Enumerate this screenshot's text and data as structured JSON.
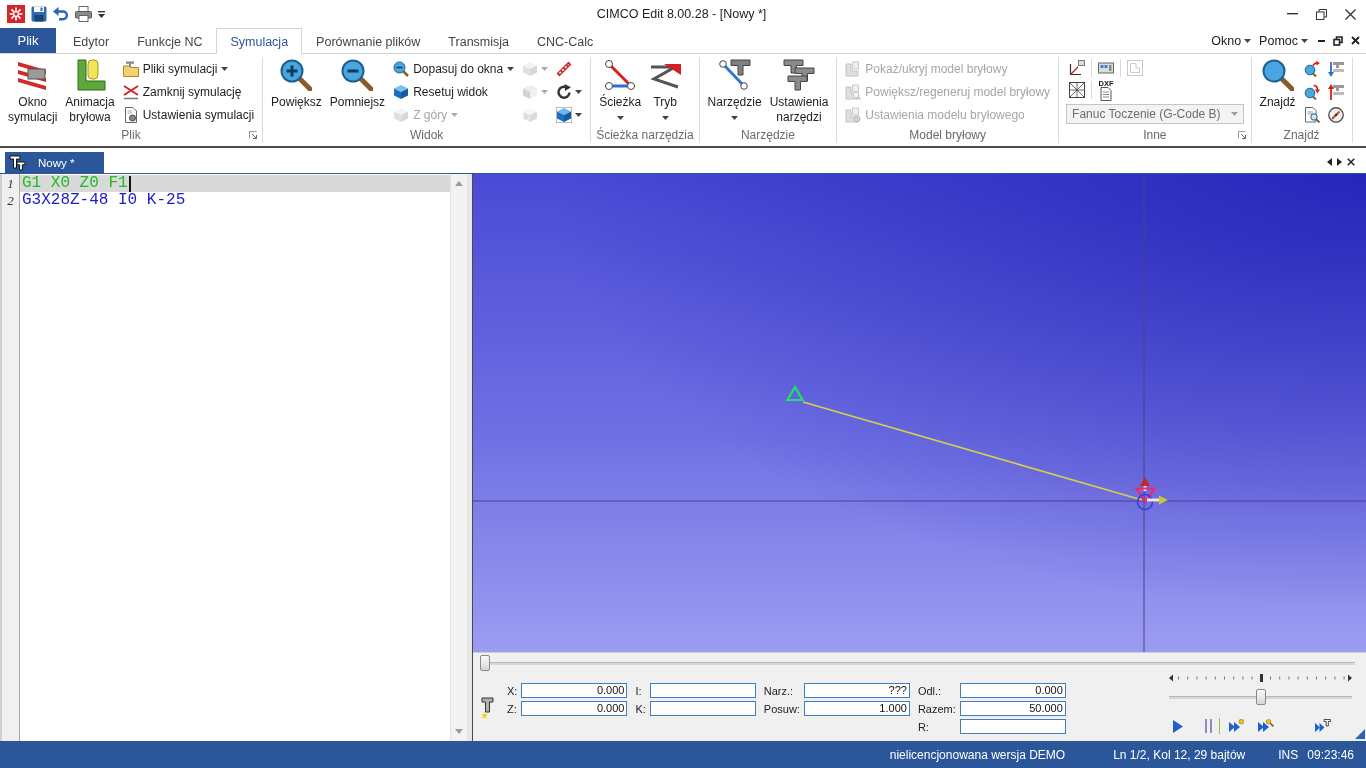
{
  "window": {
    "title": "CIMCO Edit 8.00.28 - [Nowy *]"
  },
  "ribbon": {
    "file_button": "Plik",
    "tabs": [
      {
        "label": "Edytor",
        "selected": false
      },
      {
        "label": "Funkcje NC",
        "selected": false
      },
      {
        "label": "Symulacja",
        "selected": true
      },
      {
        "label": "Porównanie plików",
        "selected": false
      },
      {
        "label": "Transmisja",
        "selected": false
      },
      {
        "label": "CNC-Calc",
        "selected": false
      }
    ],
    "menus": [
      {
        "label": "Okno"
      },
      {
        "label": "Pomoc"
      }
    ],
    "groups": [
      {
        "label": "Plik",
        "launcher": true,
        "columns": [
          {
            "kind": "large",
            "label": "Okno symulacji",
            "dropdown": false,
            "disabled": false
          },
          {
            "kind": "large",
            "label": "Animacja bryłowa",
            "dropdown": false,
            "disabled": false
          },
          {
            "kind": "stack",
            "items": [
              {
                "label": "Pliki symulacji",
                "dropdown": true,
                "disabled": false
              },
              {
                "label": "Zamknij symulację",
                "dropdown": false,
                "disabled": false
              },
              {
                "label": "Ustawienia symulacji",
                "dropdown": false,
                "disabled": false
              }
            ]
          }
        ]
      },
      {
        "label": "Widok",
        "launcher": false,
        "columns": [
          {
            "kind": "large",
            "label": "Powiększ",
            "dropdown": false,
            "disabled": false
          },
          {
            "kind": "large",
            "label": "Pomniejsz",
            "dropdown": false,
            "disabled": false
          },
          {
            "kind": "stack",
            "items": [
              {
                "label": "Dopasuj do okna",
                "dropdown": true,
                "disabled": false
              },
              {
                "label": "Resetuj widok",
                "dropdown": false,
                "disabled": false
              },
              {
                "label": "Z góry",
                "dropdown": true,
                "disabled": true
              }
            ]
          },
          {
            "kind": "icons",
            "items": [
              {
                "dropdown": true,
                "disabled": true
              },
              {
                "dropdown": true,
                "disabled": true
              },
              {
                "dropdown": false,
                "disabled": true
              }
            ]
          },
          {
            "kind": "icons",
            "items": [
              {
                "dropdown": false,
                "disabled": false
              },
              {
                "dropdown": true,
                "disabled": false
              },
              {
                "dropdown": true,
                "disabled": false
              }
            ]
          }
        ]
      },
      {
        "label": "Ścieżka narzędzia",
        "launcher": false,
        "columns": [
          {
            "kind": "large",
            "label": "Ścieżka",
            "dropdown": true,
            "disabled": false
          },
          {
            "kind": "large",
            "label": "Tryb",
            "dropdown": true,
            "disabled": false
          }
        ]
      },
      {
        "label": "Narzędzie",
        "launcher": false,
        "columns": [
          {
            "kind": "large",
            "label": "Narzędzie",
            "dropdown": true,
            "disabled": false
          },
          {
            "kind": "large",
            "label": "Ustawienia narzędzi",
            "dropdown": false,
            "disabled": false
          }
        ]
      },
      {
        "label": "Model bryłowy",
        "launcher": false,
        "columns": [
          {
            "kind": "stack",
            "items": [
              {
                "label": "Pokaż/ukryj model bryłowy",
                "dropdown": false,
                "disabled": true
              },
              {
                "label": "Powiększ/regeneruj model bryłowy",
                "dropdown": false,
                "disabled": true
              },
              {
                "label": "Ustawienia modelu bryłowego",
                "dropdown": false,
                "disabled": true
              }
            ]
          }
        ]
      },
      {
        "label": "Inne",
        "launcher": true,
        "columns": [
          {
            "kind": "panel",
            "icon_rows": [
              [
                {
                  "disabled": false
                },
                {
                  "disabled": false
                },
                {
                  "disabled": true
                }
              ],
              [
                {
                  "disabled": false
                },
                {
                  "caption": "DXF",
                  "disabled": false
                }
              ]
            ],
            "combo": {
              "value": "Fanuc Toczenie (G-Code B)",
              "disabled": true
            }
          }
        ]
      },
      {
        "label": "Znajdź",
        "launcher": false,
        "columns": [
          {
            "kind": "large",
            "label": "Znajdź",
            "dropdown": false,
            "disabled": false
          },
          {
            "kind": "icons",
            "items": [
              {
                "dropdown": false,
                "disabled": false
              },
              {
                "dropdown": false,
                "disabled": false
              },
              {
                "dropdown": false,
                "disabled": false
              }
            ]
          },
          {
            "kind": "icons",
            "items": [
              {
                "dropdown": false,
                "disabled": false
              },
              {
                "dropdown": false,
                "disabled": false
              },
              {
                "dropdown": false,
                "disabled": false
              }
            ]
          }
        ]
      }
    ]
  },
  "document_tabs": [
    {
      "label": "Nowy *",
      "selected": true
    }
  ],
  "editor": {
    "lines": [
      {
        "number": "1",
        "text": "G1 X0 Z0 F1",
        "current": true
      },
      {
        "number": "2",
        "text": "G3X28Z-48 I0 K-25",
        "current": false
      }
    ]
  },
  "simulation": {
    "timeline": {
      "level": 0
    },
    "readout_columns": [
      {
        "fields": [
          {
            "label": "X:",
            "value": "0.000"
          },
          {
            "label": "Z:",
            "value": "0.000"
          }
        ]
      },
      {
        "fields": [
          {
            "label": "I:"
          },
          {
            "label": "K:"
          }
        ]
      },
      {
        "fields": [
          {
            "label": "Narz.:",
            "value": "???"
          },
          {
            "label": "Posuw:",
            "value": "1.000"
          }
        ]
      },
      {
        "fields": [
          {
            "label": "Odl.:",
            "value": "0.000"
          },
          {
            "label": "Razem:",
            "value": "50.000"
          },
          {
            "label": "R:"
          }
        ]
      }
    ],
    "speed": {
      "level": 0.5
    }
  },
  "status_bar": {
    "license": "nielicencjonowana wersja DEMO",
    "position": "Ln 1/2, Kol 12, 29 bajtów",
    "mode": "INS",
    "time": "09:23:46"
  }
}
